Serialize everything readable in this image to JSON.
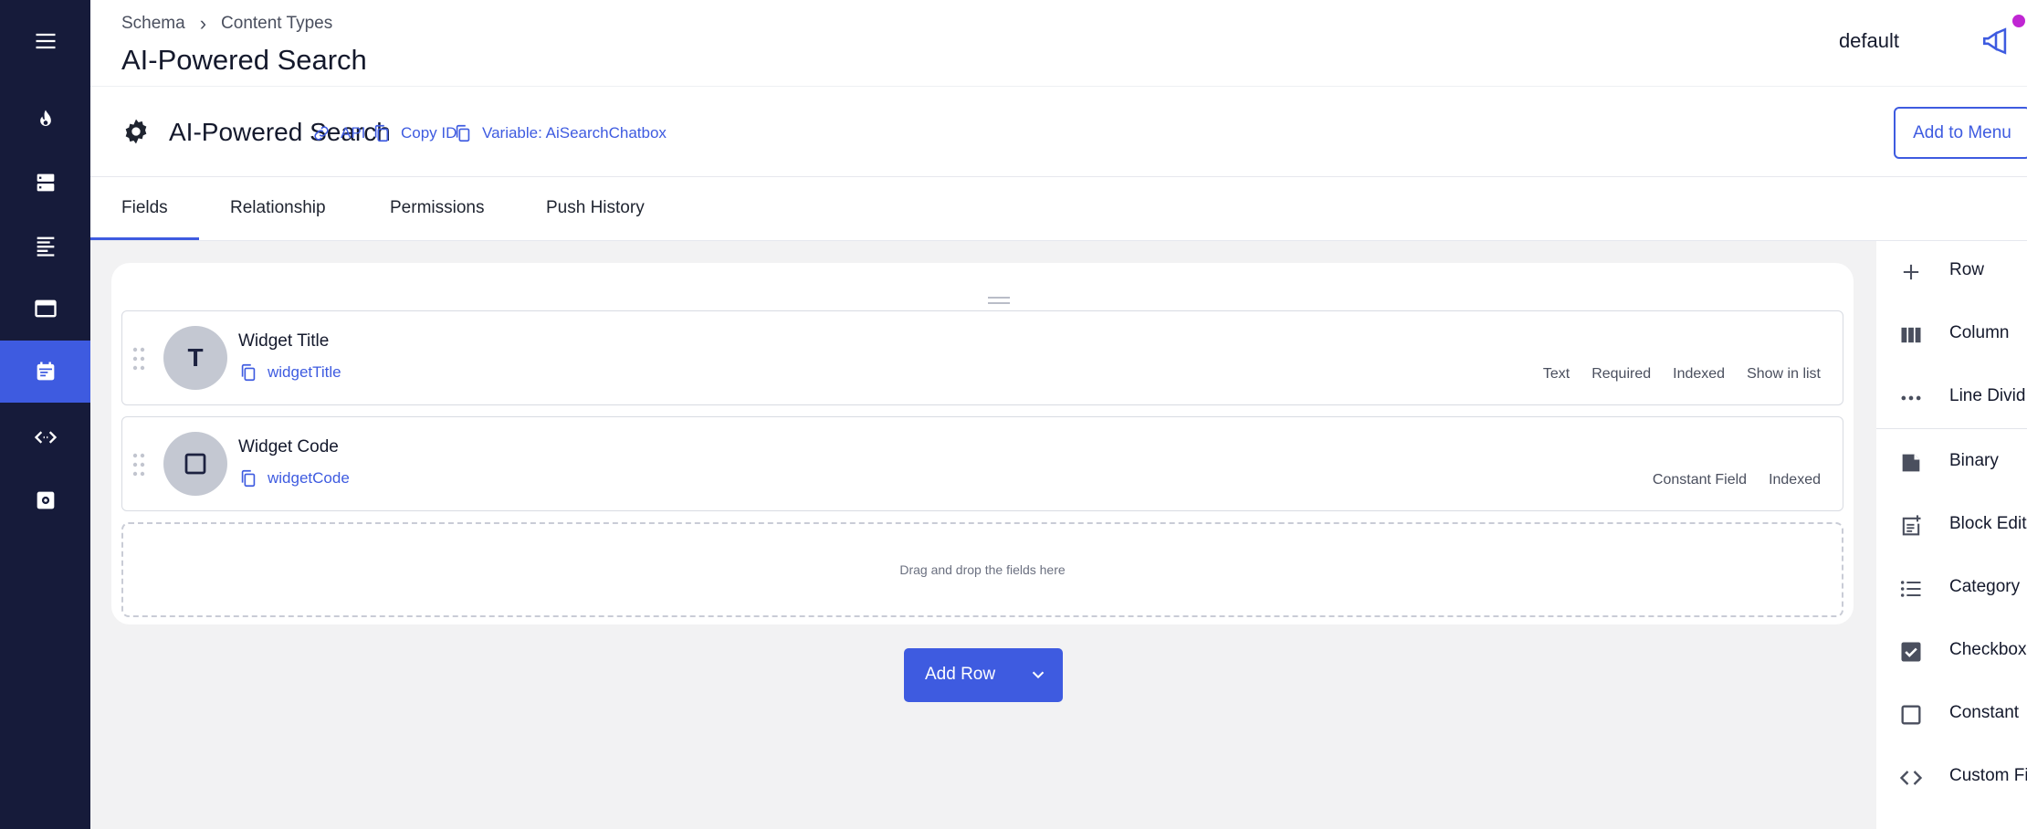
{
  "header": {
    "breadcrumb": [
      "Schema",
      "Content Types"
    ],
    "title": "AI-Powered Search",
    "environment": "default"
  },
  "content_type": {
    "name": "AI-Powered Search",
    "links": {
      "api": "API",
      "copy_id": "Copy ID",
      "variable": "Variable: AiSearchChatbox"
    },
    "add_to_menu": "Add to Menu"
  },
  "tabs": [
    "Fields",
    "Relationship",
    "Permissions",
    "Push History"
  ],
  "active_tab": "Fields",
  "fields": [
    {
      "avatar": "T",
      "name": "Widget Title",
      "key": "widgetTitle",
      "attributes": [
        "Text",
        "Required",
        "Indexed",
        "Show in list"
      ]
    },
    {
      "avatar": "",
      "name": "Widget Code",
      "key": "widgetCode",
      "attributes": [
        "Constant Field",
        "Indexed"
      ]
    }
  ],
  "dropzone_text": "Drag and drop the fields here",
  "add_row_label": "Add Row",
  "right_panel": {
    "layout_items": [
      "Row",
      "Column",
      "Line Divid"
    ],
    "field_items": [
      "Binary",
      "Block Edit",
      "Category",
      "Checkbox",
      "Constant",
      "Custom Fi"
    ]
  },
  "colors": {
    "nav_bg": "#161b3a",
    "accent": "#3e5be0",
    "notification": "#c026d3"
  },
  "icons": {
    "nav": [
      "menu-icon",
      "flame-icon",
      "database-icon",
      "list-icon",
      "window-icon",
      "calendar-icon",
      "code-icon",
      "settings-icon"
    ],
    "active_nav": "calendar-icon"
  }
}
